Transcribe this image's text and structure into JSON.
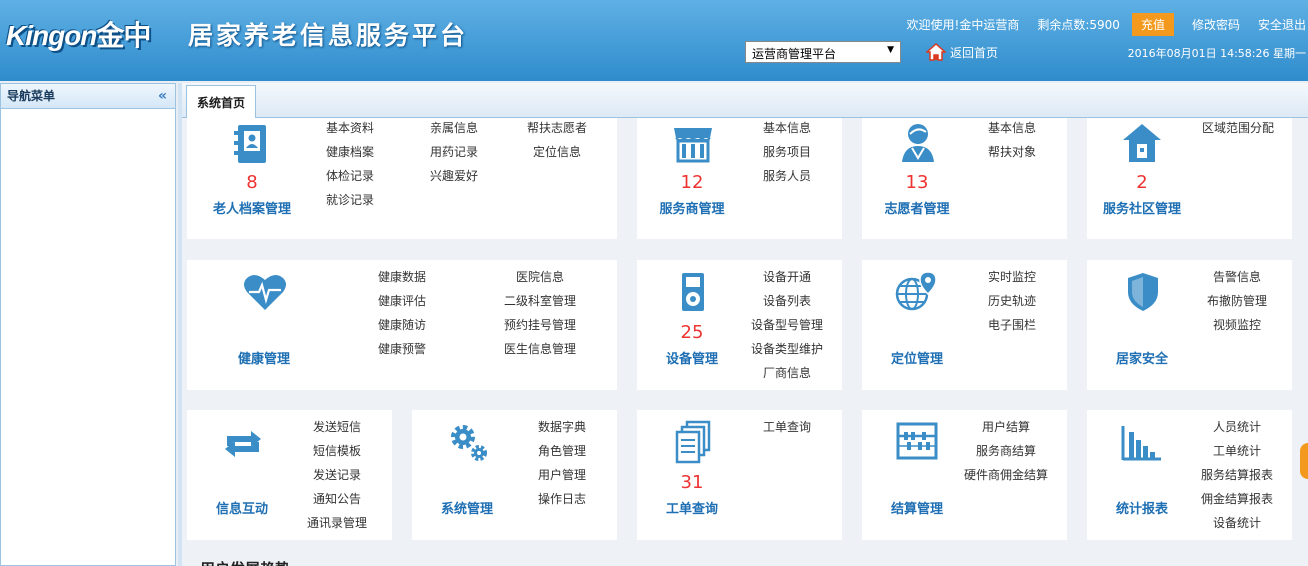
{
  "header": {
    "logo_text": "Kingon",
    "logo_cn": "金中",
    "title": "居家养老信息服务平台",
    "welcome": "欢迎使用!金中运营商",
    "points": "剩余点数:5900",
    "recharge": "充值",
    "change_password": "修改密码",
    "logout": "安全退出",
    "datetime": "2016年08月01日 14:58:26 星期一",
    "platform_select": "运营商管理平台",
    "home_link": "返回首页"
  },
  "sidebar": {
    "title": "导航菜单",
    "collapse": "«"
  },
  "tabs": {
    "home": "系统首页"
  },
  "section_title": "用户发展趋势",
  "cards": {
    "elderly": {
      "count": "8",
      "name": "老人档案管理",
      "links": [
        "基本资料",
        "健康档案",
        "体检记录",
        "就诊记录",
        "亲属信息",
        "用药记录",
        "兴趣爱好",
        "帮扶志愿者",
        "定位信息"
      ]
    },
    "provider": {
      "count": "12",
      "name": "服务商管理",
      "links": [
        "基本信息",
        "服务项目",
        "服务人员"
      ]
    },
    "volunteer": {
      "count": "13",
      "name": "志愿者管理",
      "links": [
        "基本信息",
        "帮扶对象"
      ]
    },
    "community": {
      "count": "2",
      "name": "服务社区管理",
      "links": [
        "区域范围分配"
      ]
    },
    "health": {
      "name": "健康管理",
      "links": [
        "健康数据",
        "健康评估",
        "健康随访",
        "健康预警",
        "医院信息",
        "二级科室管理",
        "预约挂号管理",
        "医生信息管理"
      ]
    },
    "device": {
      "count": "25",
      "name": "设备管理",
      "links": [
        "设备开通",
        "设备列表",
        "设备型号管理",
        "设备类型维护",
        "厂商信息"
      ]
    },
    "location": {
      "name": "定位管理",
      "links": [
        "实时监控",
        "历史轨迹",
        "电子围栏"
      ]
    },
    "security": {
      "name": "居家安全",
      "links": [
        "告警信息",
        "布撤防管理",
        "视频监控"
      ]
    },
    "interaction": {
      "name": "信息互动",
      "links": [
        "发送短信",
        "短信模板",
        "发送记录",
        "通知公告",
        "通讯录管理"
      ]
    },
    "system": {
      "name": "系统管理",
      "links": [
        "数据字典",
        "角色管理",
        "用户管理",
        "操作日志"
      ]
    },
    "workorder": {
      "count": "31",
      "name": "工单查询",
      "links": [
        "工单查询"
      ]
    },
    "settlement": {
      "name": "结算管理",
      "links": [
        "用户结算",
        "服务商结算",
        "硬件商佣金结算"
      ]
    },
    "reports": {
      "name": "统计报表",
      "links": [
        "人员统计",
        "工单统计",
        "服务结算报表",
        "佣金结算报表",
        "设备统计"
      ]
    }
  },
  "colors": {
    "accent": "#2d8ac6",
    "icon": "#3a8dc6",
    "count": "#e33333",
    "recharge": "#f39a1e"
  }
}
